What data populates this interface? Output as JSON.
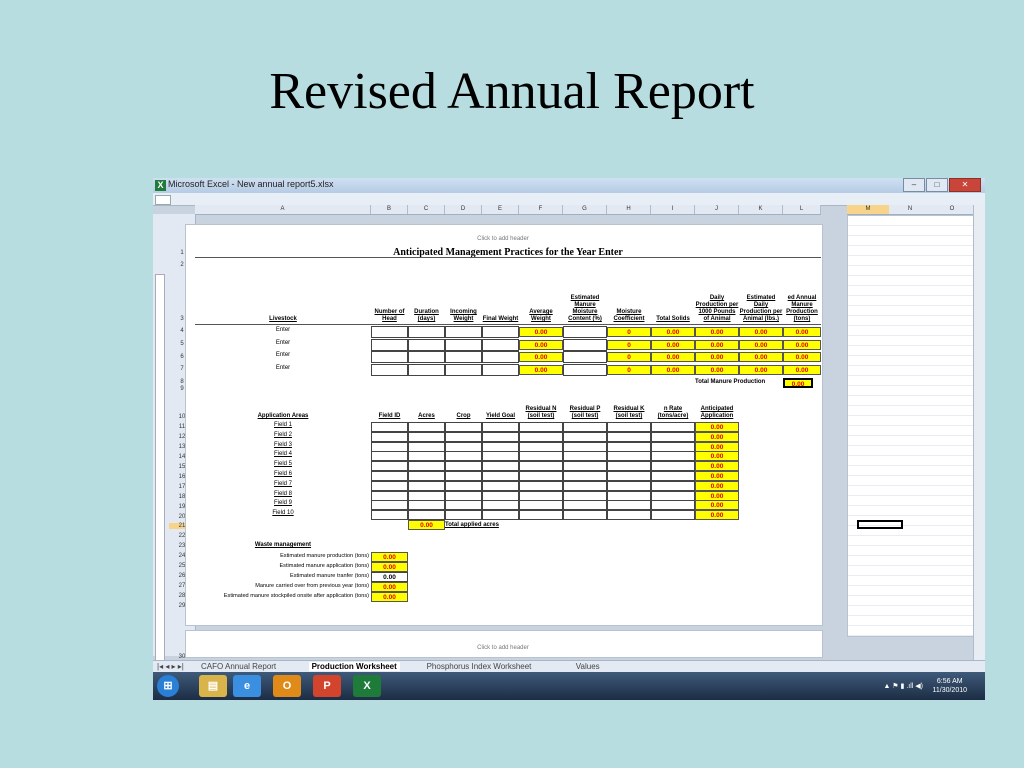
{
  "slide": {
    "title": "Revised Annual Report"
  },
  "window": {
    "title": "Microsoft Excel - New annual report5.xlsx",
    "app_icon": "excel-icon"
  },
  "columns": [
    "A",
    "B",
    "C",
    "D",
    "E",
    "F",
    "G",
    "H",
    "I",
    "J",
    "K",
    "L"
  ],
  "right_columns": [
    "M",
    "N",
    "O"
  ],
  "rows": [
    "1",
    "2",
    "3",
    "4",
    "5",
    "6",
    "7",
    "8",
    "9",
    "10",
    "11",
    "12",
    "13",
    "14",
    "15",
    "16",
    "17",
    "18",
    "19",
    "20",
    "21",
    "22",
    "23",
    "24",
    "25",
    "26",
    "27",
    "28",
    "29",
    "30"
  ],
  "header_hint": "Click to add header",
  "sheet": {
    "title": "Anticipated Management Practices for the Year Enter",
    "livestock_headers": [
      "Livestock",
      "Number of Head",
      "Duration (days)",
      "Incoming Weight",
      "Final Weight",
      "Average Weight",
      "Estimated Manure Moisture Content (%)",
      "Moisture Coefficient",
      "Total Solids",
      "Daily Production per 1000 Pounds of Animal",
      "Estimated Daily Production per Animal (lbs.)",
      "ed Annual Manure Production (tons)"
    ],
    "livestock_rows": [
      {
        "label": "Enter",
        "avg": "0.00",
        "coef": "0",
        "solids": "0.00",
        "daily": "0.00",
        "est": "0.00",
        "annual": "0.00"
      },
      {
        "label": "Enter",
        "avg": "0.00",
        "coef": "0",
        "solids": "0.00",
        "daily": "0.00",
        "est": "0.00",
        "annual": "0.00"
      },
      {
        "label": "Enter",
        "avg": "0.00",
        "coef": "0",
        "solids": "0.00",
        "daily": "0.00",
        "est": "0.00",
        "annual": "0.00"
      },
      {
        "label": "Enter",
        "avg": "0.00",
        "coef": "0",
        "solids": "0.00",
        "daily": "0.00",
        "est": "0.00",
        "annual": "0.00"
      }
    ],
    "total_manure_label": "Total Manure Production",
    "total_manure_value": "0.00",
    "app_headers": [
      "Application Areas",
      "Field ID",
      "Acres",
      "Crop",
      "Yield Goal",
      "Residual N (soil test)",
      "Residual P (soil test)",
      "Residual K (soil test)",
      "n Rate (tons/acre)",
      "Anticipated Application"
    ],
    "fields": [
      "Field 1",
      "Field 2",
      "Field 3",
      "Field 4",
      "Field 5",
      "Field 6",
      "Field 7",
      "Field 8",
      "Field 9",
      "Field 10"
    ],
    "field_values": [
      "0.00",
      "0.00",
      "0.00",
      "0.00",
      "0.00",
      "0.00",
      "0.00",
      "0.00",
      "0.00",
      "0.00"
    ],
    "total_acres_value": "0.00",
    "total_acres_label": "Total applied acres",
    "waste_title": "Waste management",
    "waste_items": [
      {
        "label": "Estimated manure production (tons)",
        "value": "0.00",
        "yellow": true
      },
      {
        "label": "Estimated manure application (tons)",
        "value": "0.00",
        "yellow": true
      },
      {
        "label": "Estimated manure tranfer (tons)",
        "value": "0.00",
        "yellow": false
      },
      {
        "label": "Manure carried over from previous year (tons)",
        "value": "0.00",
        "yellow": true
      },
      {
        "label": "Estimated manure stockpiled onsite after application (tons)",
        "value": "0.00",
        "yellow": true
      }
    ]
  },
  "sheet_tabs": [
    "CAFO Annual Report",
    "Production Worksheet",
    "Phosphorus Index Worksheet",
    "Values"
  ],
  "active_tab": "Production Worksheet",
  "taskbar": {
    "apps": [
      "start-icon",
      "explorer-icon",
      "ie-icon",
      "outlook-icon",
      "powerpoint-icon",
      "excel-icon"
    ],
    "time": "6:56 AM",
    "date": "11/30/2010"
  }
}
